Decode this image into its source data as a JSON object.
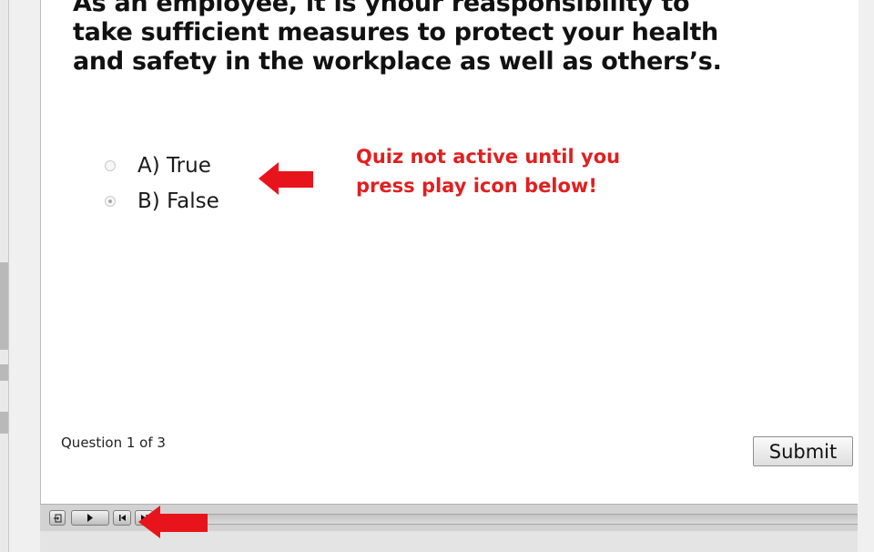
{
  "quiz": {
    "question": "As an employee, it is ynour reasponsibility to take sufficient measures to protect your health and safety in the workplace as well as others’s.",
    "options": [
      {
        "label": "A) True",
        "selected": false
      },
      {
        "label": "B) False",
        "selected": true
      }
    ],
    "counter": "Question 1 of 3",
    "submit_label": "Submit"
  },
  "annotation": {
    "line1": "Quiz not active until you",
    "line2": "press play icon below!",
    "color": "#e02020"
  },
  "playbar": {
    "buttons": [
      "exit-icon",
      "play-icon",
      "rewind-icon",
      "forward-icon"
    ]
  }
}
